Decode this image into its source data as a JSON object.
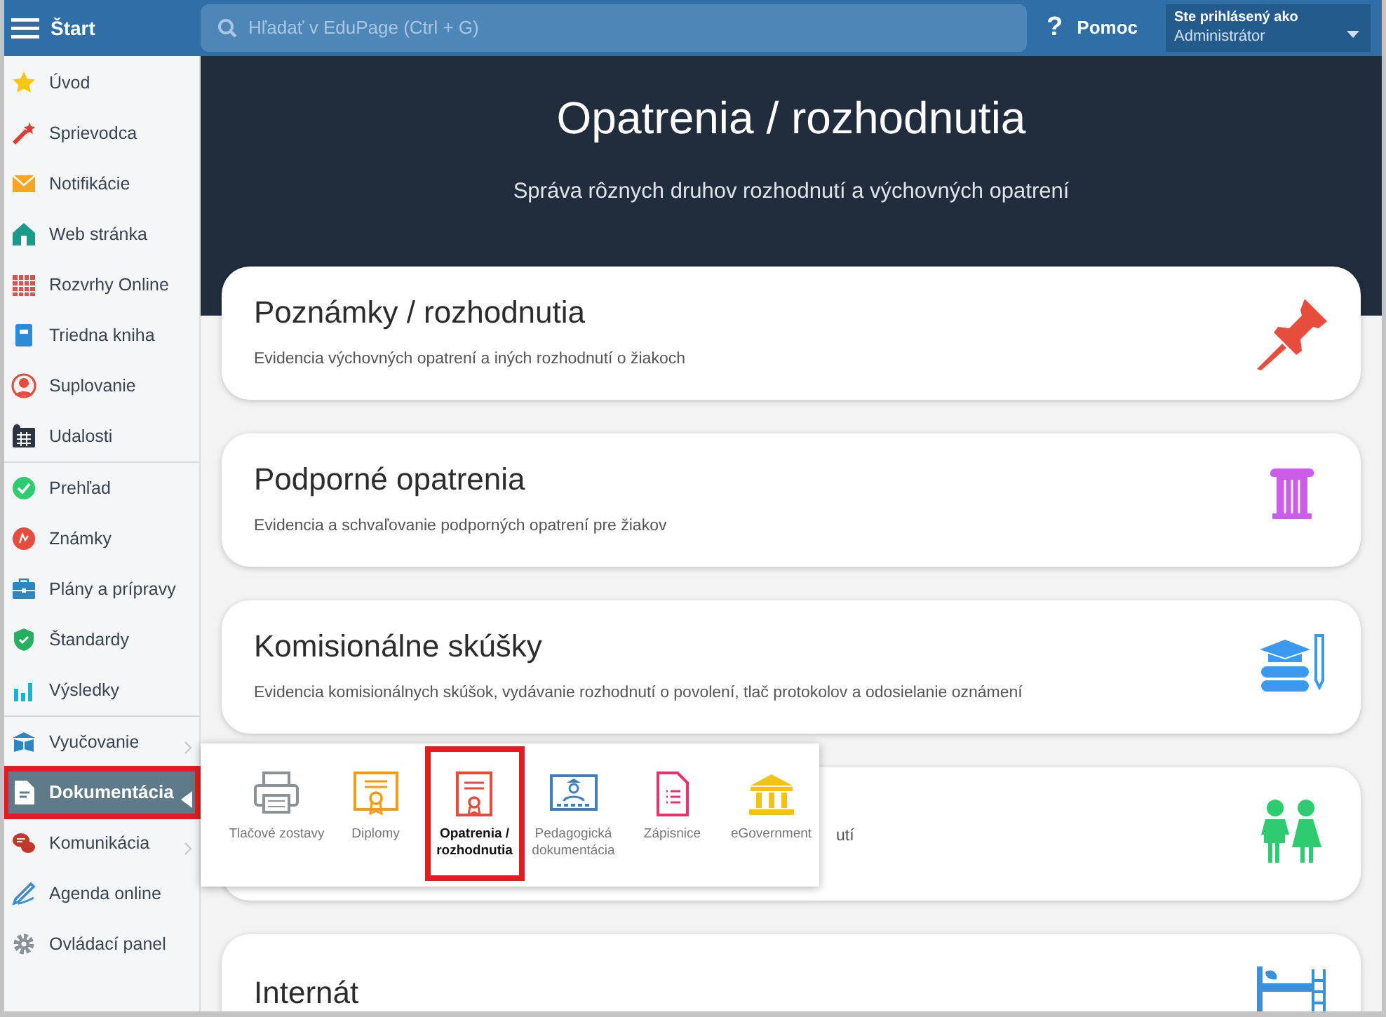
{
  "topbar": {
    "menu_label": "Štart",
    "search": {
      "placeholder": "Hľadať v EduPage (Ctrl + G)"
    },
    "help_symbol": "?",
    "help_label": "Pomoc",
    "user": {
      "caption": "Ste prihlásený ako",
      "role": "Administrátor"
    }
  },
  "sidebar": {
    "groups": [
      [
        {
          "label": "Úvod",
          "selected": false,
          "submenu": false
        },
        {
          "label": "Sprievodca",
          "selected": false,
          "submenu": false
        },
        {
          "label": "Notifikácie",
          "selected": false,
          "submenu": false
        },
        {
          "label": "Web stránka",
          "selected": false,
          "submenu": false
        },
        {
          "label": "Rozvrhy Online",
          "selected": false,
          "submenu": false
        },
        {
          "label": "Triedna kniha",
          "selected": false,
          "submenu": false
        },
        {
          "label": "Suplovanie",
          "selected": false,
          "submenu": false
        },
        {
          "label": "Udalosti",
          "selected": false,
          "submenu": false
        }
      ],
      [
        {
          "label": "Prehľad",
          "selected": false,
          "submenu": false
        },
        {
          "label": "Známky",
          "selected": false,
          "submenu": false
        },
        {
          "label": "Plány a prípravy",
          "selected": false,
          "submenu": false
        },
        {
          "label": "Štandardy",
          "selected": false,
          "submenu": false
        },
        {
          "label": "Výsledky",
          "selected": false,
          "submenu": false
        }
      ],
      [
        {
          "label": "Vyučovanie",
          "selected": false,
          "submenu": true
        },
        {
          "label": "Dokumentácia",
          "selected": true,
          "submenu": true
        },
        {
          "label": "Komunikácia",
          "selected": false,
          "submenu": true
        },
        {
          "label": "Agenda online",
          "selected": false,
          "submenu": false
        },
        {
          "label": "Ovládací panel",
          "selected": false,
          "submenu": false
        }
      ]
    ]
  },
  "header": {
    "title": "Opatrenia / rozhodnutia",
    "subtitle": "Správa rôznych druhov rozhodnutí a výchovných opatrení"
  },
  "cards": [
    {
      "title": "Poznámky / rozhodnutia",
      "description": "Evidencia výchovných opatrení a iných rozhodnutí o žiakoch"
    },
    {
      "title": "Podporné opatrenia",
      "description": "Evidencia a schvaľovanie podporných opatrení pre žiakov"
    },
    {
      "title": "Komisionálne skúšky",
      "description": "Evidencia komisionálnych skúšok, vydávanie rozhodnutí o povolení, tlač protokolov a odosielanie oznámení"
    },
    {
      "description": "utí"
    },
    {
      "title": "Internát"
    }
  ],
  "submenu": [
    {
      "label": "Tlačové zostavy",
      "selected": false
    },
    {
      "label": "Diplomy",
      "selected": false
    },
    {
      "label": "Opatrenia / rozhodnutia",
      "selected": true
    },
    {
      "label": "Pedagogická dokumentácia",
      "selected": false
    },
    {
      "label": "Zápisnice",
      "selected": false
    },
    {
      "label": "eGovernment",
      "selected": false
    }
  ]
}
